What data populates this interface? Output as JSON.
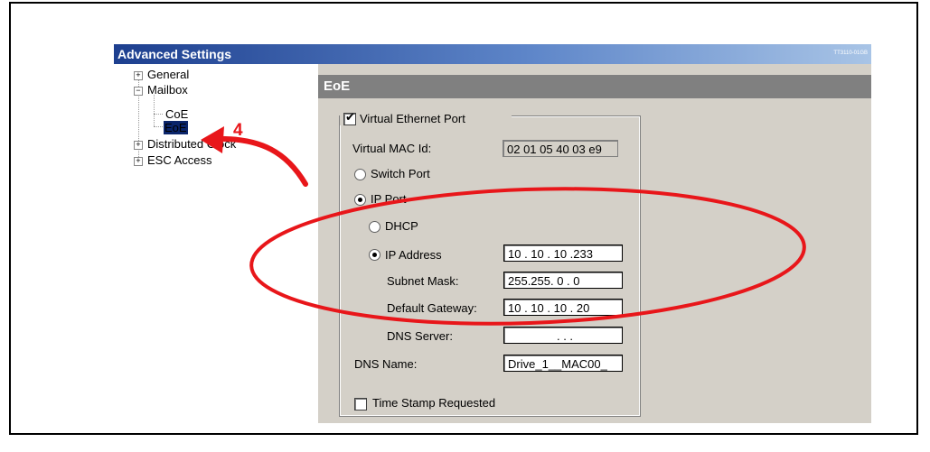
{
  "window": {
    "title": "Advanced Settings",
    "doc_id": "TT3110-01GB"
  },
  "tree": {
    "general": "General",
    "mailbox": "Mailbox",
    "coe": "CoE",
    "eoe": "EoE",
    "distributed_clock": "Distributed Clock",
    "esc_access": "ESC Access"
  },
  "annotation": {
    "step_number": "4",
    "color": "#e8161a"
  },
  "panel": {
    "header": "EoE",
    "virtual_ethernet_port": {
      "label": "Virtual Ethernet Port",
      "checked": true
    },
    "virtual_mac": {
      "label": "Virtual MAC Id:",
      "value": "02 01 05 40 03 e9"
    },
    "switch_port": {
      "label": "Switch Port",
      "selected": false
    },
    "ip_port": {
      "label": "IP Port",
      "selected": true
    },
    "dhcp": {
      "label": "DHCP",
      "selected": false
    },
    "ip_address": {
      "label": "IP Address",
      "selected": true,
      "value": "10 . 10 . 10 .233"
    },
    "subnet_mask": {
      "label": "Subnet Mask:",
      "value": "255.255. 0 . 0"
    },
    "default_gateway": {
      "label": "Default Gateway:",
      "value": "10 . 10 . 10 . 20"
    },
    "dns_server": {
      "label": "DNS Server:",
      "value": ".       .       ."
    },
    "dns_name": {
      "label": "DNS Name:",
      "value": "Drive_1__MAC00_"
    },
    "time_stamp": {
      "label": "Time Stamp Requested",
      "checked": false
    }
  }
}
